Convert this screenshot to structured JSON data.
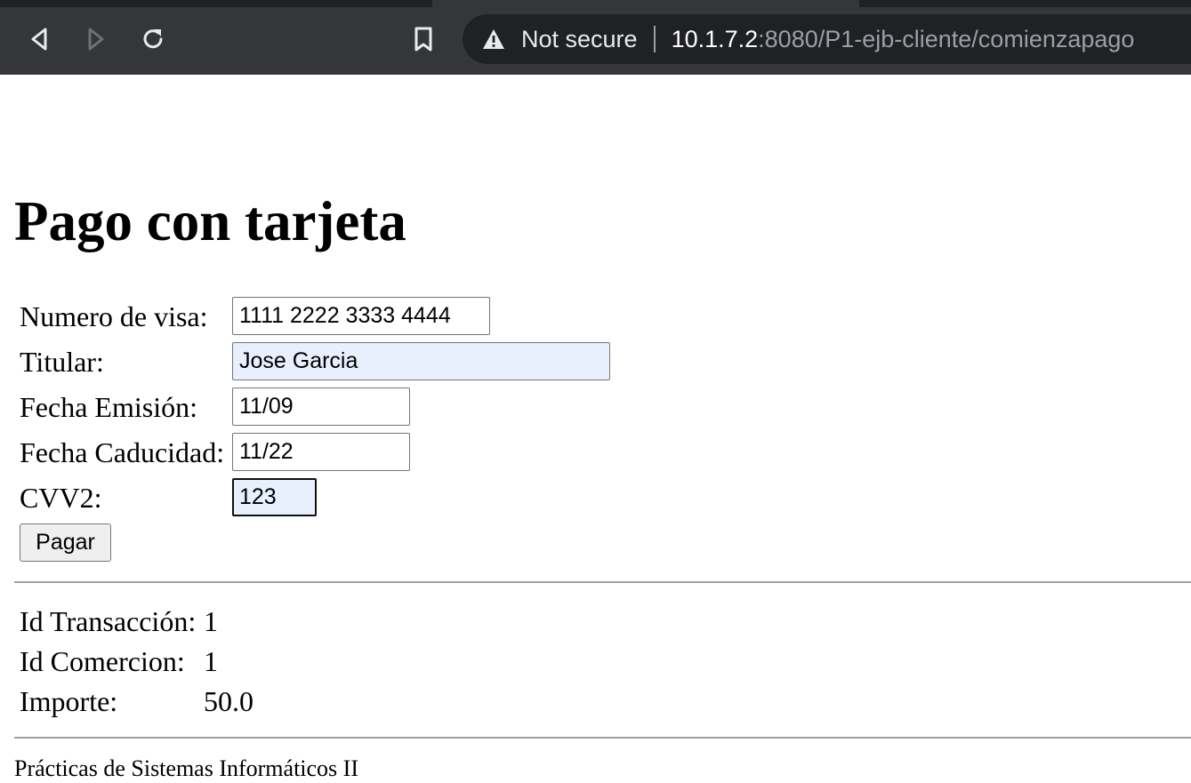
{
  "browser": {
    "security_label": "Not secure",
    "url_host": "10.1.7.2",
    "url_rest": ":8080/P1-ejb-cliente/comienzapago",
    "icons": [
      "back-icon",
      "forward-icon",
      "reload-icon",
      "bookmark-icon",
      "warning-icon"
    ]
  },
  "page": {
    "title": "Pago con tarjeta",
    "form": {
      "visa_label": "Numero de visa:",
      "visa_value": "1111 2222 3333 4444",
      "titular_label": "Titular:",
      "titular_value": "Jose Garcia",
      "emision_label": "Fecha Emisión:",
      "emision_value": "11/09",
      "caducidad_label": "Fecha Caducidad:",
      "caducidad_value": "11/22",
      "cvv_label": "CVV2:",
      "cvv_value": "123",
      "submit_label": "Pagar"
    },
    "result": {
      "transaccion_label": "Id Transacción:",
      "transaccion_value": "1",
      "comercio_label": "Id Comercion:",
      "comercio_value": "1",
      "importe_label": "Importe:",
      "importe_value": "50.0"
    },
    "footer": "Prácticas de Sistemas Informáticos II"
  },
  "colors": {
    "chrome_bg": "#35363a",
    "omnibox_bg": "#202124",
    "autofill_bg": "#e8f0fe"
  }
}
